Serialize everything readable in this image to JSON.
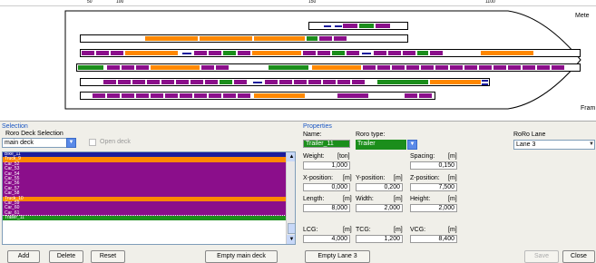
{
  "colors": {
    "accent": "#1a56c4",
    "car": "#8b0e8b",
    "truck": "#ff8800",
    "trailer": "#1b8e1b",
    "bike": "#1c1c9c",
    "selected": "#1c1c9c"
  },
  "ruler": {
    "ticks": [
      "50",
      "100",
      "150",
      "1100"
    ]
  },
  "side_labels": {
    "mete": "Mete",
    "fram": "Fram"
  },
  "selection": {
    "title": "Selection",
    "deck_selection_label": "Roro Deck Selection",
    "deck_value": "main deck",
    "open_deck_label": "Open deck",
    "items": [
      {
        "label": "Bike_11",
        "type": "bike"
      },
      {
        "label": "Truck_9",
        "type": "truck"
      },
      {
        "label": "Car_52",
        "type": "car"
      },
      {
        "label": "Car_53",
        "type": "car"
      },
      {
        "label": "Car_54",
        "type": "car"
      },
      {
        "label": "Car_55",
        "type": "car"
      },
      {
        "label": "Car_56",
        "type": "car"
      },
      {
        "label": "Car_57",
        "type": "car"
      },
      {
        "label": "Car_58",
        "type": "car"
      },
      {
        "label": "Truck_10",
        "type": "truck"
      },
      {
        "label": "Car_59",
        "type": "car"
      },
      {
        "label": "Car_60",
        "type": "car"
      },
      {
        "label": "Car_61",
        "type": "car"
      },
      {
        "label": "Trailer_11",
        "type": "trailer"
      }
    ]
  },
  "properties": {
    "title": "Properties",
    "name_label": "Name:",
    "name_value": "Trailer_11",
    "roro_type_label": "Roro type:",
    "roro_type_value": "Trailer",
    "roro_lane_label": "RoRo Lane",
    "roro_lane_value": "Lane 3",
    "weight": {
      "label": "Weight:",
      "unit": "[ton]",
      "value": "1,000"
    },
    "spacing": {
      "label": "Spacing:",
      "unit": "[m]",
      "value": "0,150"
    },
    "xpos": {
      "label": "X-position:",
      "unit": "[m]",
      "value": "0,000"
    },
    "ypos": {
      "label": "Y-position:",
      "unit": "[m]",
      "value": "0,200"
    },
    "zpos": {
      "label": "Z-position:",
      "unit": "[m]",
      "value": "7,500"
    },
    "length": {
      "label": "Length:",
      "unit": "[m]",
      "value": "8,000"
    },
    "width": {
      "label": "Width:",
      "unit": "[m]",
      "value": "2,000"
    },
    "height": {
      "label": "Height:",
      "unit": "[m]",
      "value": "2,000"
    },
    "lcg": {
      "label": "LCG:",
      "unit": "[m]",
      "value": "4,000"
    },
    "tcg": {
      "label": "TCG:",
      "unit": "[m]",
      "value": "1,200"
    },
    "vcg": {
      "label": "VCG:",
      "unit": "[m]",
      "value": "8,400"
    }
  },
  "buttons": {
    "add": "Add",
    "delete": "Delete",
    "reset": "Reset",
    "empty_main": "Empty main deck",
    "empty_lane": "Empty Lane 3",
    "save": "Save",
    "close": "Close"
  }
}
